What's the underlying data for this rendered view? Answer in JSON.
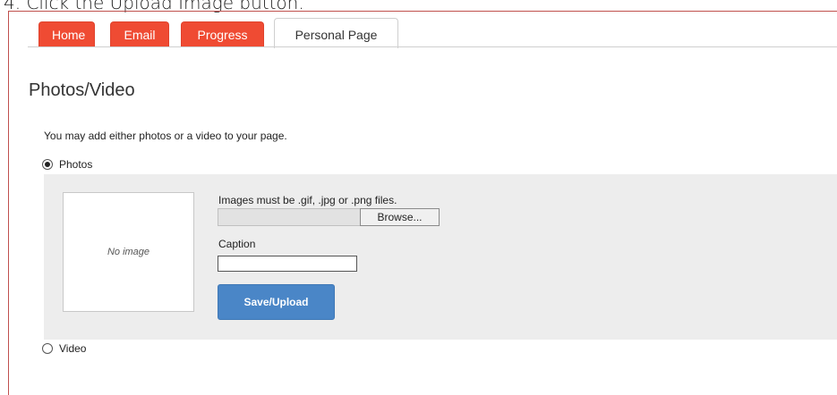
{
  "instruction": "4. Click the Upload Image button.",
  "tabs": {
    "home": "Home",
    "email": "Email",
    "progress": "Progress",
    "personal_page": "Personal Page"
  },
  "section": {
    "title": "Photos/Video",
    "intro": "You may add either photos or a video to your page."
  },
  "options": {
    "photos": "Photos",
    "video": "Video",
    "selected": "Photos"
  },
  "upload": {
    "no_image_text": "No image",
    "rules": "Images must be .gif, .jpg or .png files.",
    "browse_label": "Browse...",
    "caption_label": "Caption",
    "caption_value": "",
    "save_label": "Save/Upload"
  },
  "colors": {
    "tab_accent": "#ef4b33",
    "button_blue": "#4a86c7",
    "frame_border": "#c0504d"
  }
}
